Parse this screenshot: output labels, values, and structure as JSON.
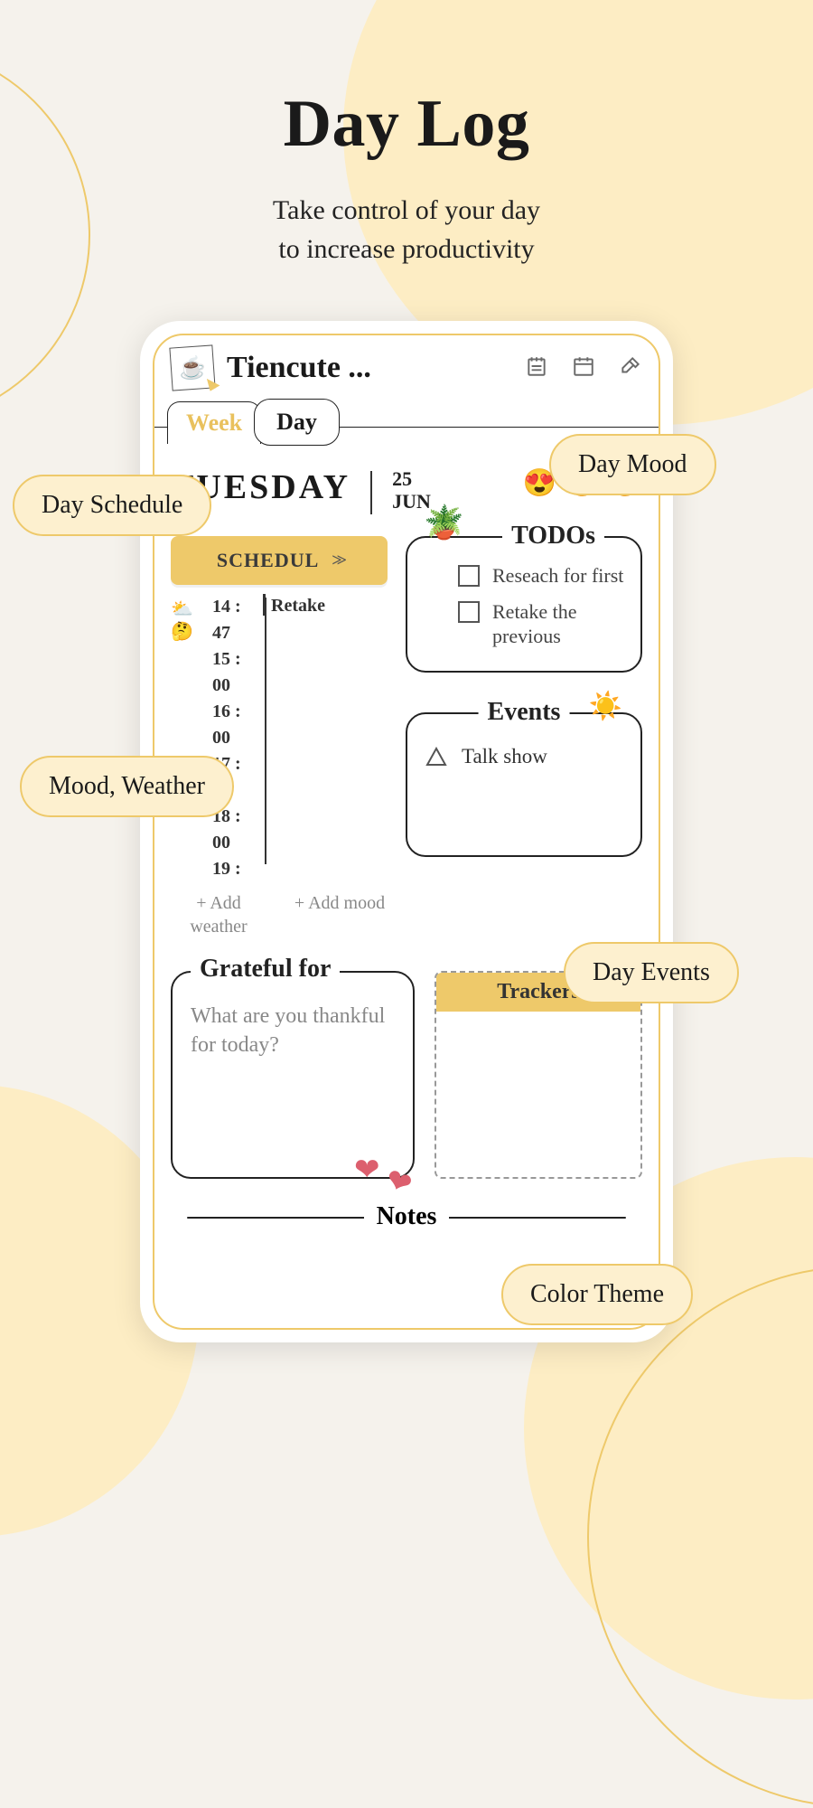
{
  "hero": {
    "title": "Day Log",
    "subtitle_line1": "Take control of your day",
    "subtitle_line2": "to increase productivity"
  },
  "callouts": {
    "day_schedule": "Day Schedule",
    "day_mood": "Day Mood",
    "mood_weather": "Mood, Weather",
    "day_events": "Day Events",
    "color_theme": "Color Theme"
  },
  "topbar": {
    "title": "Tiencute ..."
  },
  "tabs": {
    "week": "Week",
    "day": "Day"
  },
  "date": {
    "day_name": "TUESDAY",
    "day_num": "25",
    "month": "JUN"
  },
  "moods": {
    "m1": "😍",
    "m2": "😐",
    "m3": "😎"
  },
  "schedule": {
    "label": "SCHEDUL",
    "icons": "⛅🤔",
    "times": [
      "14 : 47",
      "15 : 00",
      "16 : 00",
      "17 : 00",
      "18 : 00",
      "19 :"
    ],
    "event": "Retake",
    "add_weather": "+ Add weather",
    "add_mood": "+ Add mood"
  },
  "todos": {
    "title": "TODOs",
    "items": [
      "Reseach for first",
      "Retake the previous"
    ]
  },
  "events": {
    "title": "Events",
    "items": [
      "Talk show"
    ]
  },
  "grateful": {
    "title": "Grateful for",
    "placeholder": "What are you thankful for today?"
  },
  "trackers": {
    "title": "Trackers"
  },
  "notes": {
    "title": "Notes"
  }
}
